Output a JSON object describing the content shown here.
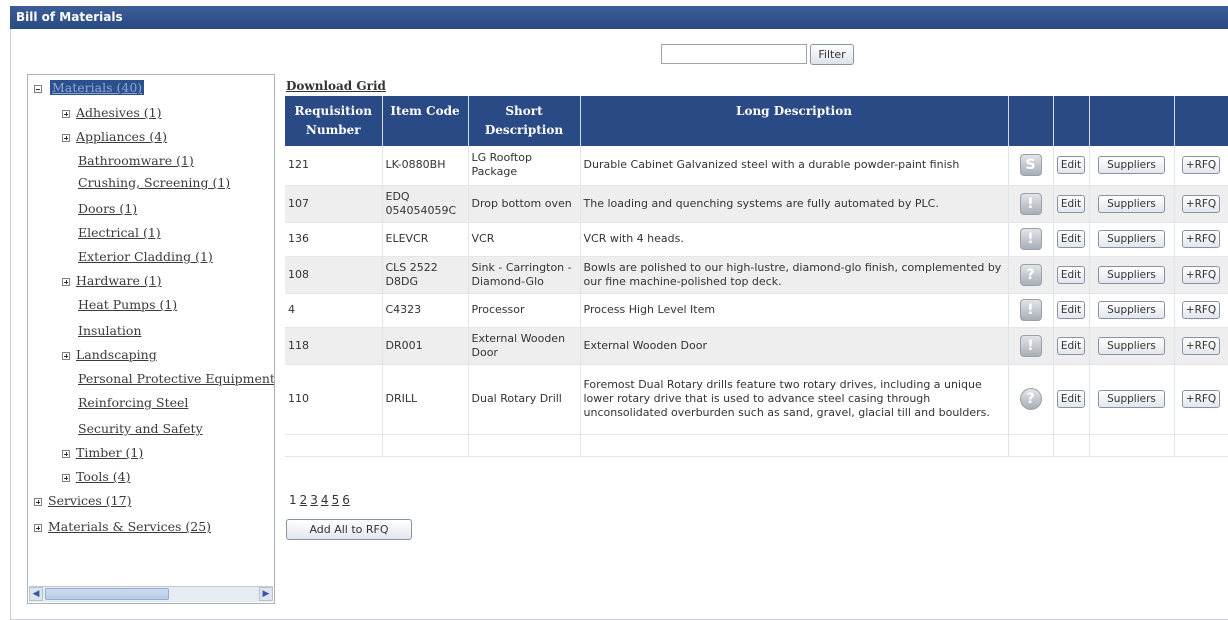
{
  "window": {
    "title": "Bill of Materials"
  },
  "filter": {
    "value": "",
    "button_label": "Filter"
  },
  "tree": {
    "root": "Materials (40)",
    "children": [
      "Adhesives (1)",
      "Appliances (4)",
      "Bathroomware (1)",
      "Crushing, Screening (1)",
      "Doors (1)",
      "Electrical (1)",
      "Exterior Cladding (1)",
      "Hardware (1)",
      "Heat Pumps (1)",
      "Insulation",
      "Landscaping",
      "Personal Protective Equipment",
      "Reinforcing Steel",
      "Security and Safety",
      "Timber (1)",
      "Tools (4)"
    ],
    "top_level": [
      "Services (17)",
      "Materials & Services (25)"
    ]
  },
  "grid": {
    "download_label": "Download Grid",
    "headers": [
      "Requisition Number",
      "Item Code",
      "Short Description",
      "Long Description"
    ],
    "edit_label": "Edit",
    "suppliers_label": "Suppliers",
    "rfq_label": "+RFQ",
    "rows": [
      {
        "req": "121",
        "code": "LK-0880BH",
        "short": "LG Rooftop Package",
        "long": "Durable Cabinet Galvanized steel with a durable powder-paint finish",
        "icon": "S",
        "icon_name": "status-s-icon"
      },
      {
        "req": "107",
        "code": "EDQ 054054059C",
        "short": "Drop bottom oven",
        "long": "The loading and quenching systems are fully automated by PLC.",
        "icon": "!",
        "icon_name": "alert-icon"
      },
      {
        "req": "136",
        "code": "ELEVCR",
        "short": "VCR",
        "long": "VCR with 4 heads.",
        "icon": "!",
        "icon_name": "alert-icon"
      },
      {
        "req": "108",
        "code": "CLS 2522 D8DG",
        "short": "Sink - Carrington - Diamond-Glo",
        "long": "Bowls are polished to our high-lustre, diamond-glo finish, complemented by our fine machine-polished top deck.",
        "icon": "?",
        "icon_name": "question-icon"
      },
      {
        "req": "4",
        "code": "C4323",
        "short": "Processor",
        "long": "Process High Level Item",
        "icon": "!",
        "icon_name": "alert-icon"
      },
      {
        "req": "118",
        "code": "DR001",
        "short": "External Wooden Door",
        "long": "External Wooden Door",
        "icon": "!",
        "icon_name": "alert-icon"
      },
      {
        "req": "110",
        "code": "DRILL",
        "short": "Dual Rotary Drill",
        "long": "Foremost Dual Rotary drills feature two rotary drives, including a unique lower rotary drive that is used to advance steel casing through unconsolidated overburden such as sand, gravel, glacial till and boulders.",
        "icon": "?",
        "icon_name": "question-round-icon"
      }
    ]
  },
  "pager": {
    "pages": [
      "1",
      "2",
      "3",
      "4",
      "5",
      "6"
    ]
  },
  "add_all_label": "Add All to RFQ",
  "colors": {
    "header": "#2a4a86",
    "titlebar": "#3c5d96"
  }
}
